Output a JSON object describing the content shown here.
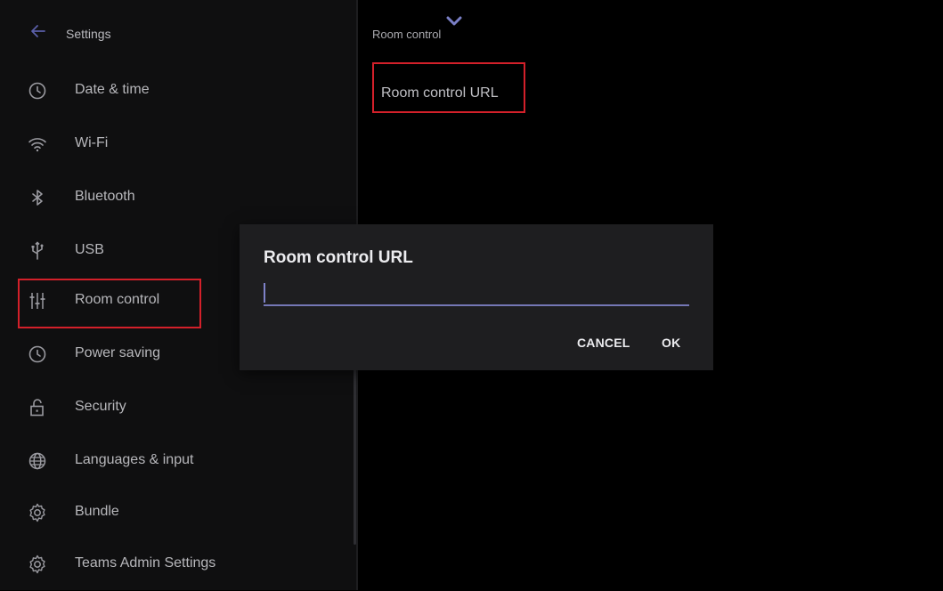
{
  "left": {
    "header": {
      "title": "Settings",
      "back_icon": "back-arrow-icon"
    },
    "items": [
      {
        "label": "Date & time",
        "icon": "clock-icon"
      },
      {
        "label": "Wi-Fi",
        "icon": "wifi-icon"
      },
      {
        "label": "Bluetooth",
        "icon": "bluetooth-icon"
      },
      {
        "label": "USB",
        "icon": "usb-icon"
      },
      {
        "label": "Room control",
        "icon": "sliders-icon"
      },
      {
        "label": "Power saving",
        "icon": "clock-icon"
      },
      {
        "label": "Security",
        "icon": "unlock-icon"
      },
      {
        "label": "Languages & input",
        "icon": "globe-icon"
      },
      {
        "label": "Bundle",
        "icon": "gear-icon"
      },
      {
        "label": "Teams Admin Settings",
        "icon": "gear-icon"
      }
    ]
  },
  "right": {
    "title": "Room control",
    "item_label": "Room control URL",
    "chevron_icon": "chevron-down-icon"
  },
  "dialog": {
    "title": "Room control URL",
    "input_value": "",
    "cancel_label": "CANCEL",
    "ok_label": "OK"
  },
  "colors": {
    "accent": "#7477b5",
    "highlight": "#d3202a",
    "dialog_bg": "#1e1e20",
    "sidebar_bg": "#0f0f10"
  }
}
